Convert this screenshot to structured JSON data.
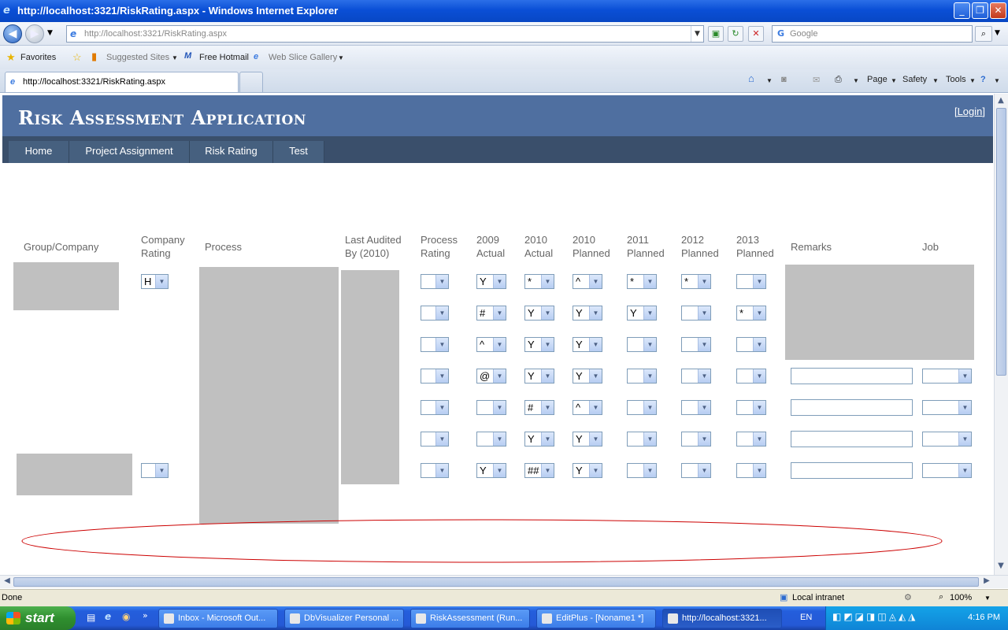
{
  "window": {
    "title": "http://localhost:3321/RiskRating.aspx - Windows Internet Explorer",
    "ie_icon": "e"
  },
  "nav": {
    "url": "http://localhost:3321/RiskRating.aspx",
    "search_placeholder": "Google"
  },
  "favorites": {
    "favorites_label": "Favorites",
    "items": [
      "Suggested Sites",
      "Free Hotmail",
      "Web Slice Gallery"
    ]
  },
  "tabs": {
    "active_tab": "http://localhost:3321/RiskRating.aspx"
  },
  "commandbar": {
    "page": "Page",
    "safety": "Safety",
    "tools": "Tools"
  },
  "app": {
    "title": "Risk Assessment Application",
    "login": "Login",
    "menu": [
      "Home",
      "Project Assignment",
      "Risk Rating",
      "Test"
    ]
  },
  "grid": {
    "headers": {
      "group_company": "Group/Company",
      "company_rating_1": "Company",
      "company_rating_2": "Rating",
      "process": "Process",
      "last_audited_1": "Last Audited",
      "last_audited_2": "By (2010)",
      "process_rating_1": "Process",
      "process_rating_2": "Rating",
      "y2009_1": "2009",
      "y2009_2": "Actual",
      "y2010a_1": "2010",
      "y2010a_2": "Actual",
      "y2010p_1": "2010",
      "y2010p_2": "Planned",
      "y2011_1": "2011",
      "y2011_2": "Planned",
      "y2012_1": "2012",
      "y2012_2": "Planned",
      "y2013_1": "2013",
      "y2013_2": "Planned",
      "remarks": "Remarks",
      "job": "Job"
    },
    "company_ratings": [
      "H",
      ""
    ],
    "rows": [
      {
        "process_rating": "",
        "a2009": "Y",
        "a2010": "*",
        "p2010": "^",
        "p2011": "*",
        "p2012": "*",
        "p2013": ""
      },
      {
        "process_rating": "",
        "a2009": "#",
        "a2010": "Y",
        "p2010": "Y",
        "p2011": "Y",
        "p2012": "",
        "p2013": "*"
      },
      {
        "process_rating": "",
        "a2009": "^",
        "a2010": "Y",
        "p2010": "Y",
        "p2011": "",
        "p2012": "",
        "p2013": ""
      },
      {
        "process_rating": "",
        "a2009": "@",
        "a2010": "Y",
        "p2010": "Y",
        "p2011": "",
        "p2012": "",
        "p2013": ""
      },
      {
        "process_rating": "",
        "a2009": "",
        "a2010": "#",
        "p2010": "^",
        "p2011": "",
        "p2012": "",
        "p2013": ""
      },
      {
        "process_rating": "",
        "a2009": "",
        "a2010": "Y",
        "p2010": "Y",
        "p2011": "",
        "p2012": "",
        "p2013": ""
      },
      {
        "process_rating": "",
        "a2009": "Y",
        "a2010": "##",
        "p2010": "Y",
        "p2011": "",
        "p2012": "",
        "p2013": ""
      }
    ]
  },
  "status": {
    "text": "Done",
    "zone": "Local intranet",
    "zoom": "100%"
  },
  "taskbar": {
    "start": "start",
    "items": [
      "Inbox - Microsoft Out...",
      "DbVisualizer Personal ...",
      "RiskAssessment (Run...",
      "EditPlus - [Noname1 *]",
      "http://localhost:3321..."
    ],
    "lang": "EN",
    "clock": "4:16 PM"
  },
  "colors": {
    "banner": "#4f6fa0",
    "menu": "#3a4f6b",
    "redacted": "#c0c0c0",
    "annotation": "#cc0000"
  }
}
